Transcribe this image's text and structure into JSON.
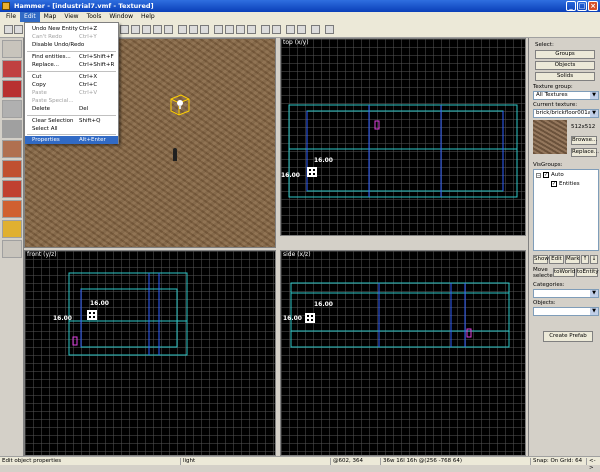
{
  "window": {
    "title": "Hammer - [industrial7.vmf - Textured]",
    "minimize": "_",
    "maximize": "□",
    "close": "×"
  },
  "menubar": [
    "File",
    "Edit",
    "Map",
    "View",
    "Tools",
    "Window",
    "Help"
  ],
  "edit_menu": {
    "items": [
      {
        "label": "Undo New Entity",
        "shortcut": "Ctrl+Z",
        "disabled": false
      },
      {
        "label": "Can't Redo",
        "shortcut": "Ctrl+Y",
        "disabled": true
      },
      {
        "label": "Disable Undo/Redo",
        "shortcut": "",
        "disabled": false
      },
      {
        "label": "Find entities...",
        "shortcut": "Ctrl+Shift+F",
        "disabled": false
      },
      {
        "label": "Replace...",
        "shortcut": "Ctrl+Shift+R",
        "disabled": false
      },
      {
        "label": "Cut",
        "shortcut": "Ctrl+X",
        "disabled": false
      },
      {
        "label": "Copy",
        "shortcut": "Ctrl+C",
        "disabled": false
      },
      {
        "label": "Paste",
        "shortcut": "Ctrl+V",
        "disabled": true
      },
      {
        "label": "Paste Special...",
        "shortcut": "",
        "disabled": true
      },
      {
        "label": "Delete",
        "shortcut": "Del",
        "disabled": false
      },
      {
        "label": "Clear Selection",
        "shortcut": "Shift+Q",
        "disabled": false
      },
      {
        "label": "Select All",
        "shortcut": "",
        "disabled": false
      },
      {
        "label": "Properties",
        "shortcut": "Alt+Enter",
        "highlighted": true
      }
    ]
  },
  "views": {
    "top_label": "top (x/y)",
    "front_label": "front (y/z)",
    "side_label": "side (x/z)",
    "top_dim_h": "16.00",
    "top_dim_v": "16.00",
    "front_dim_h": "16.00",
    "front_dim_v": "16.00",
    "side_dim_h": "16.00",
    "side_dim_v": "16.00"
  },
  "right_panel": {
    "select_label": "Select:",
    "groups_button": "Groups",
    "objects_button": "Objects",
    "solids_button": "Solids",
    "texture_group_label": "Texture group:",
    "texture_group_value": "All Textures",
    "current_texture_label": "Current texture:",
    "current_texture_value": "brick/brickfloor001a",
    "texture_size": "512x512",
    "browse_button": "Browse...",
    "replace_button": "Replace...",
    "visgroups_label": "VisGroups:",
    "visgroup_auto": "Auto",
    "visgroup_entities": "Entities",
    "show_button": "Show",
    "edit_button": "Edit",
    "mark_button": "Mark",
    "move_selected_label": "Move selected:",
    "to_world_button": "toWorld",
    "to_entity_button": "toEntity",
    "categories_label": "Categories:",
    "objects_label": "Objects:",
    "create_prefab_button": "Create Prefab"
  },
  "status": {
    "message": "Edit object properties",
    "selection": "light",
    "coords": "@602, 364",
    "size": "36w 16l 16h @(256 -768 64)",
    "grid": "Snap: On Grid: 64",
    "extra": "<->"
  },
  "colors": {
    "brush_outline": "#2ec8c8",
    "selection": "#ffffff",
    "entity_marker": "#e040e0"
  }
}
